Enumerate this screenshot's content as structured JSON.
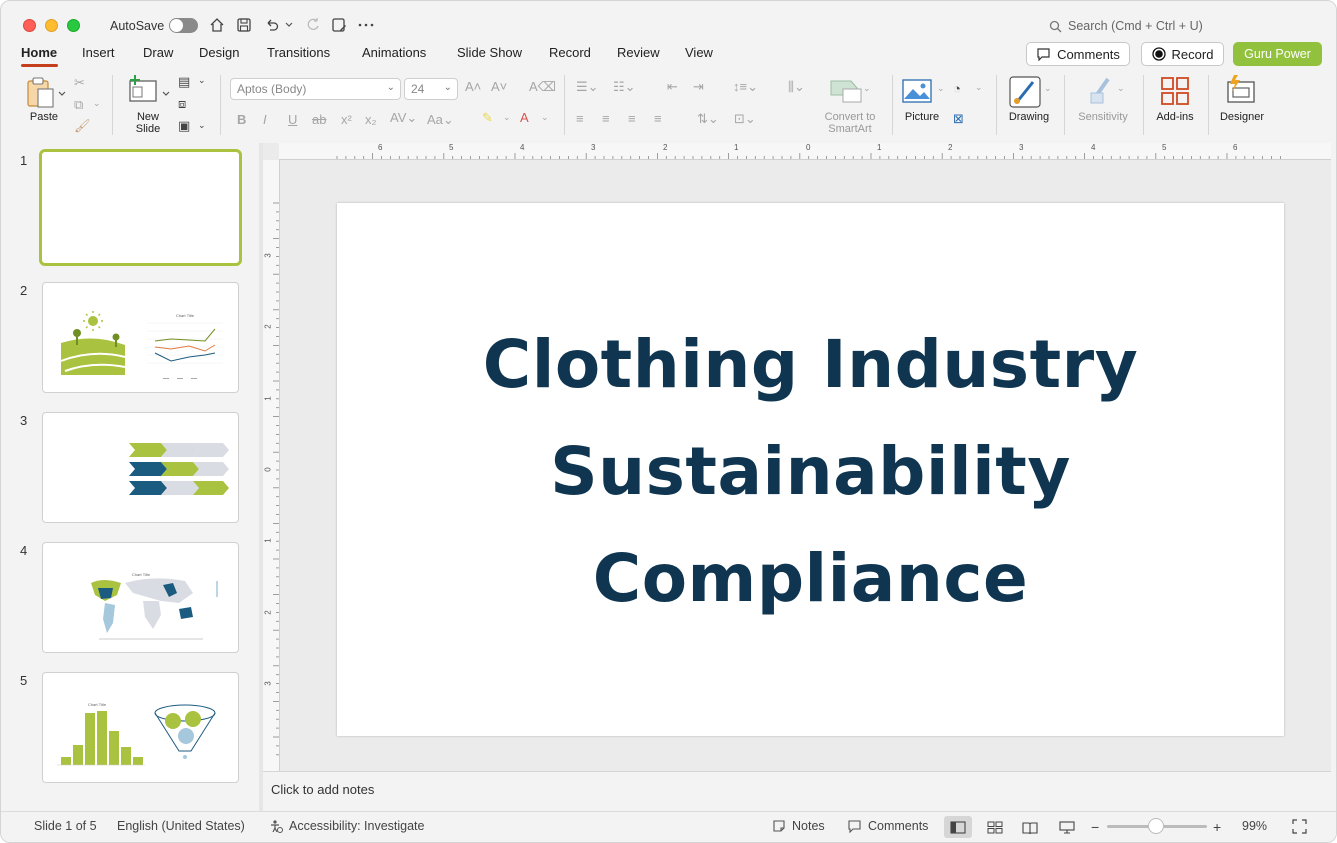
{
  "titlebar": {
    "autosave_label": "AutoSave",
    "search_placeholder": "Search (Cmd + Ctrl + U)"
  },
  "tabs": [
    {
      "label": "Home"
    },
    {
      "label": "Insert"
    },
    {
      "label": "Draw"
    },
    {
      "label": "Design"
    },
    {
      "label": "Transitions"
    },
    {
      "label": "Animations"
    },
    {
      "label": "Slide Show"
    },
    {
      "label": "Record"
    },
    {
      "label": "Review"
    },
    {
      "label": "View"
    }
  ],
  "actions": {
    "comments_label": "Comments",
    "record_label": "Record",
    "guru_label": "Guru Power"
  },
  "ribbon": {
    "paste_label": "Paste",
    "new_slide_label_1": "New",
    "new_slide_label_2": "Slide",
    "font_name": "Aptos (Body)",
    "font_size": "24",
    "smartart_label_1": "Convert to",
    "smartart_label_2": "SmartArt",
    "picture_label": "Picture",
    "drawing_label": "Drawing",
    "sensitivity_label": "Sensitivity",
    "addins_label": "Add-ins",
    "designer_label": "Designer"
  },
  "thumbnails": [
    {
      "number": "1"
    },
    {
      "number": "2"
    },
    {
      "number": "3"
    },
    {
      "number": "4"
    },
    {
      "number": "5"
    }
  ],
  "thumb_text": {
    "chart_title": "Chart Title"
  },
  "ruler": {
    "h": [
      "6",
      "5",
      "4",
      "3",
      "2",
      "1",
      "0",
      "1",
      "2",
      "3",
      "4",
      "5",
      "6"
    ],
    "v": [
      "3",
      "2",
      "1",
      "0",
      "1",
      "2",
      "3"
    ]
  },
  "slide": {
    "title_line_1": "Clothing Industry",
    "title_line_2": "Sustainability",
    "title_line_3": "Compliance"
  },
  "notes": {
    "placeholder": "Click to add notes"
  },
  "status": {
    "slide_counter": "Slide 1 of 5",
    "language": "English (United States)",
    "accessibility": "Accessibility: Investigate",
    "notes_label": "Notes",
    "comments_label": "Comments",
    "zoom": "99%"
  },
  "colors": {
    "accent_green": "#a9c23f",
    "title_navy": "#0f3550",
    "dark_teal": "#1c5b80",
    "light_gray": "#d9dde3"
  }
}
